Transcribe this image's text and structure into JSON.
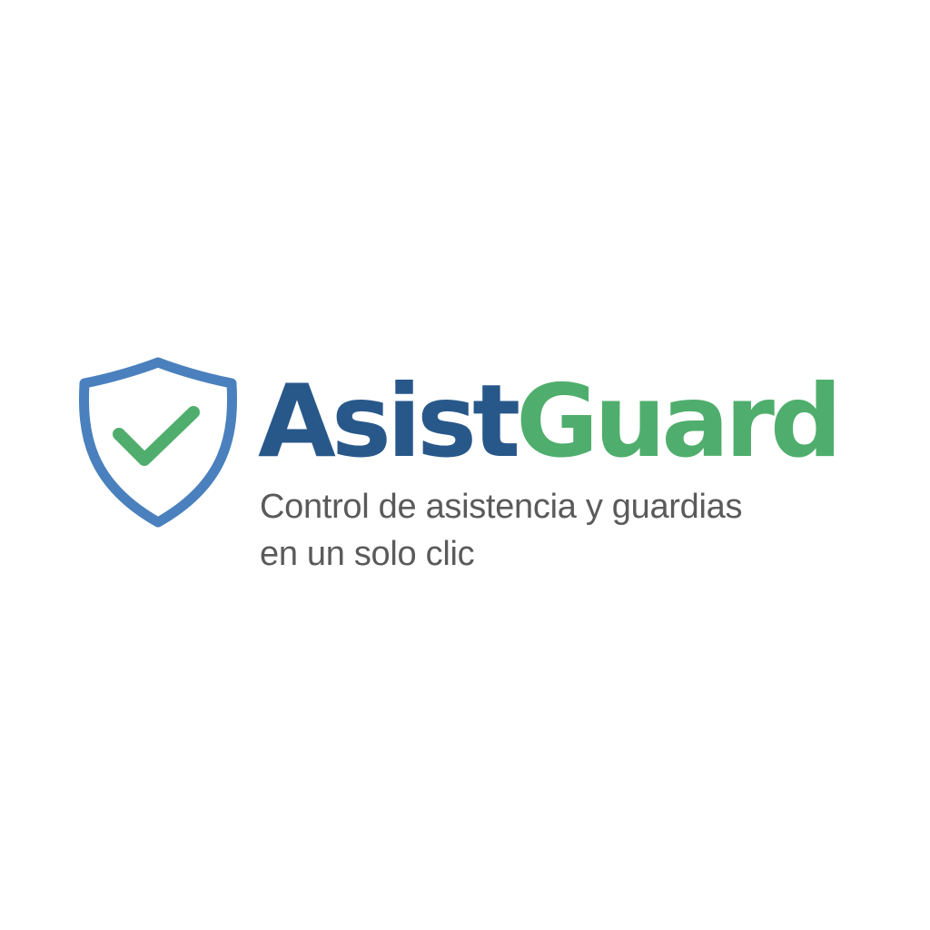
{
  "brand": {
    "name_part_1": "Asist",
    "name_part_2": "Guard",
    "tagline_line_1": "Control de asistencia y guardias",
    "tagline_line_2": "en un solo clic",
    "logo_icon": "shield-check-icon"
  },
  "colors": {
    "background": "#ffffff",
    "primary_blue": "#28588a",
    "shield_outline_blue": "#4a80bd",
    "accent_green": "#4fae6d",
    "tagline_gray": "#5a5a5a"
  }
}
